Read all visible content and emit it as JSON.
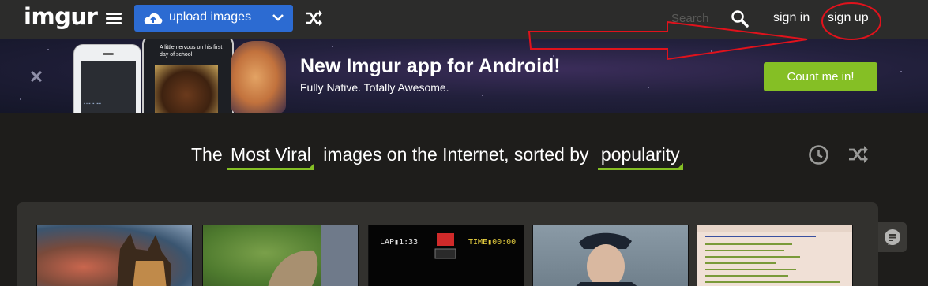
{
  "header": {
    "logo": "imgur",
    "upload_label": "upload images",
    "search_placeholder": "Search",
    "signin_label": "sign in",
    "signup_label": "sign up"
  },
  "banner": {
    "title": "New Imgur app for Android!",
    "subtitle": "Fully Native. Totally Awesome.",
    "cta_label": "Count me in!",
    "phone_caption": "A little nervous on his first day of school"
  },
  "gallery_header": {
    "prefix": "The",
    "section": "Most Viral",
    "middle": "images on the Internet, sorted by",
    "sort": "popularity"
  },
  "colors": {
    "upload_blue": "#2c6bd2",
    "accent_green": "#85bf25",
    "annotation_red": "#e0121c"
  },
  "icons": [
    "menu-icon",
    "cloud-upload-icon",
    "chevron-down-icon",
    "shuffle-icon",
    "search-icon",
    "close-icon",
    "clock-icon",
    "comment-icon"
  ],
  "thumbnails": [
    {
      "kind": "dogs"
    },
    {
      "kind": "squirrel"
    },
    {
      "kind": "game"
    },
    {
      "kind": "police"
    },
    {
      "kind": "text-post"
    }
  ]
}
